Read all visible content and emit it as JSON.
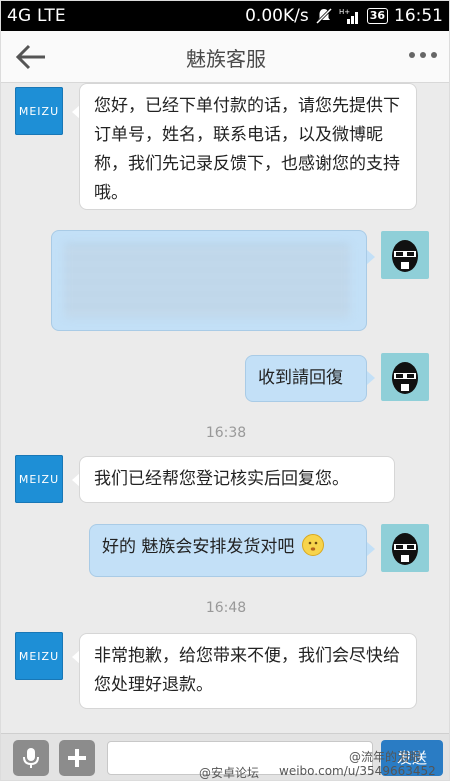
{
  "status_bar": {
    "network": "4G LTE",
    "speed": "0.00K/s",
    "signal_label": "H+",
    "battery": "36",
    "time": "16:51"
  },
  "header": {
    "title": "魅族客服"
  },
  "avatars": {
    "meizu_label": "MEIZU"
  },
  "messages": [
    {
      "side": "left",
      "text": "您好，已经下单付款的话，请您先提供下订单号，姓名，联系电话，以及微博昵称，我们先记录反馈下，也感谢您的支持哦。"
    },
    {
      "side": "right",
      "text": ""
    },
    {
      "side": "right",
      "text": "收到請回復"
    },
    {
      "side": "left",
      "text": "我们已经帮您登记核实后回复您。"
    },
    {
      "side": "right",
      "text": "好的  魅族会安排发货对吧"
    },
    {
      "side": "left",
      "text": "非常抱歉，给您带来不便，我们会尽快给您处理好退款。"
    }
  ],
  "timestamps": [
    "16:38",
    "16:48"
  ],
  "input_bar": {
    "send_label": "发送"
  },
  "watermark": {
    "left": "@安卓论坛",
    "center": "weibo.com/u/3549663452",
    "right": "@流年的泪眼"
  }
}
